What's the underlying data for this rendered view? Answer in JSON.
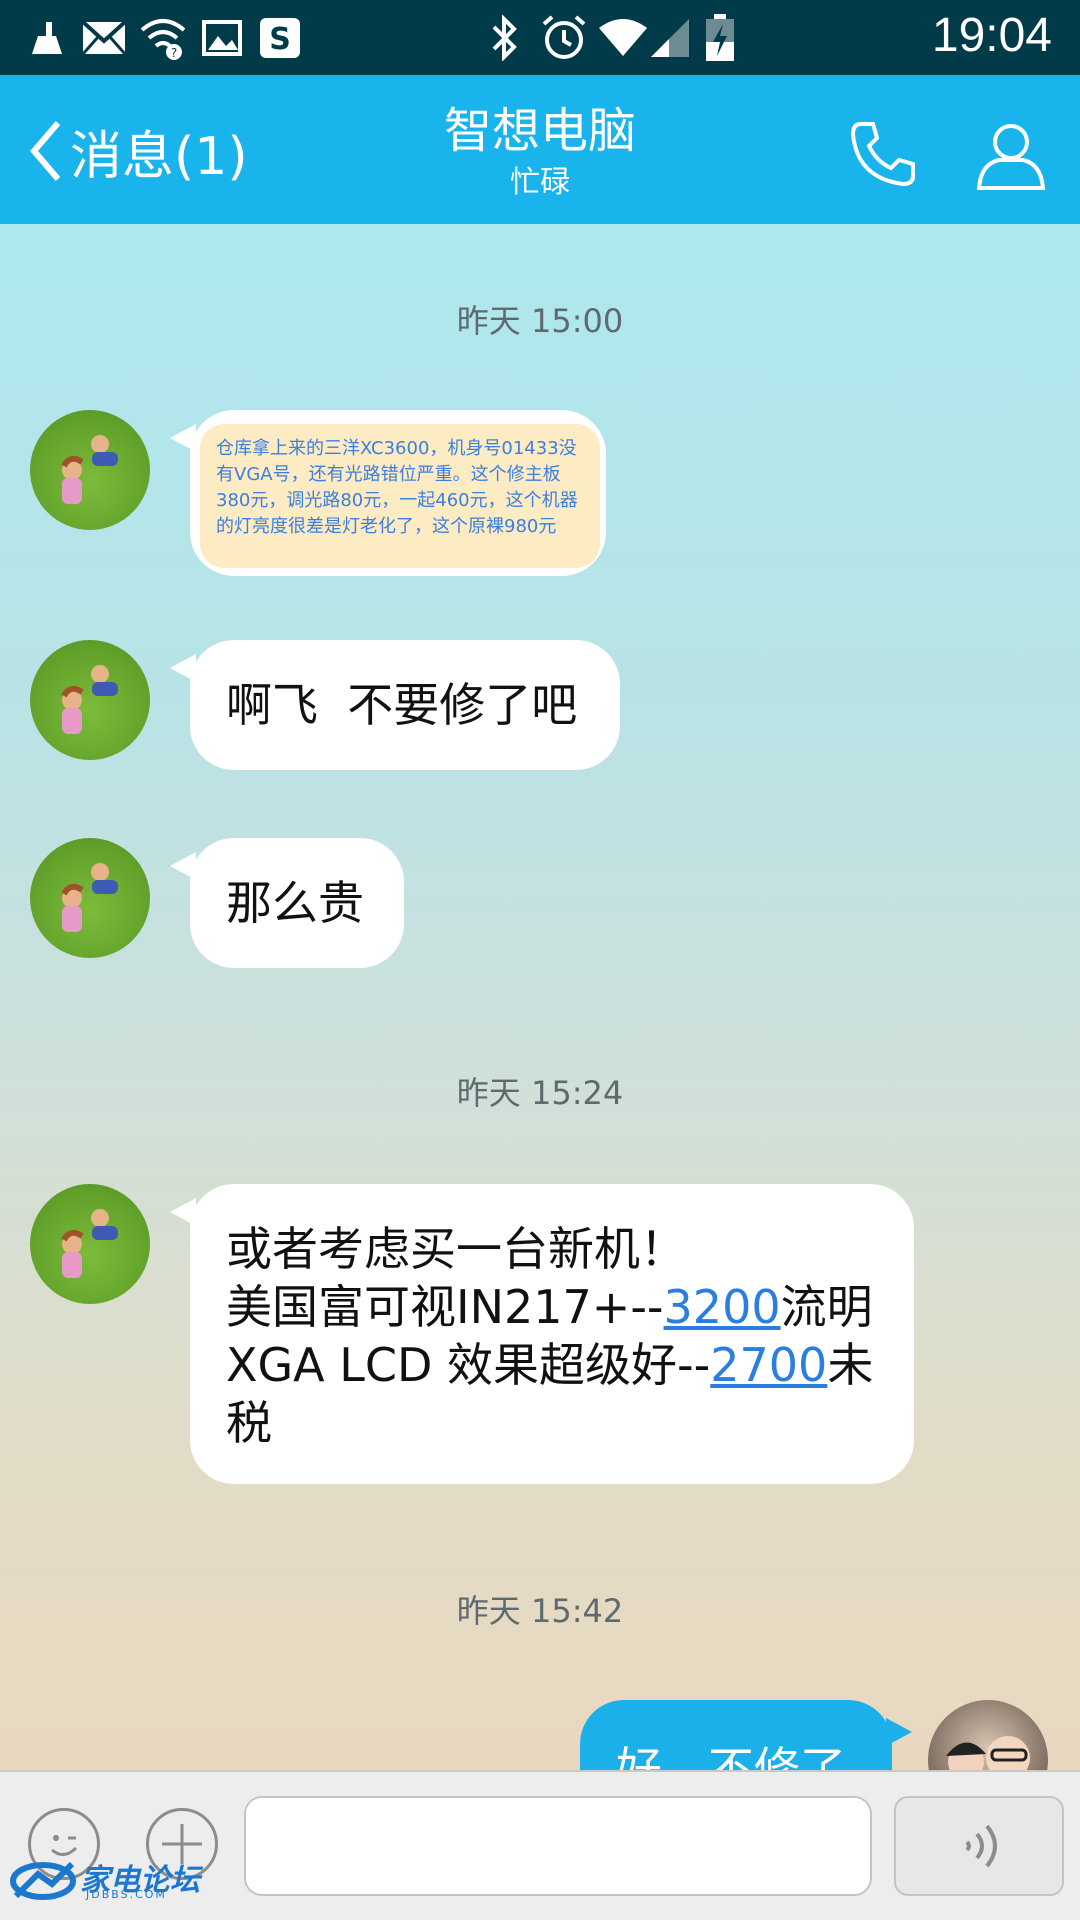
{
  "status_bar": {
    "time": "19:04",
    "left_icons": [
      "cleaner-icon",
      "mail-icon",
      "wifi-question-icon",
      "image-icon",
      "s-app-icon"
    ],
    "right_icons": [
      "bluetooth-icon",
      "alarm-icon",
      "wifi-icon",
      "signal-icon",
      "battery-charging-icon"
    ]
  },
  "header": {
    "back_label": "消息(1)",
    "title": "智想电脑",
    "subtitle": "忙碌",
    "phone_icon": "phone-icon",
    "profile_icon": "person-icon",
    "accent_color": "#19b4eb"
  },
  "chat": {
    "timestamps": [
      "昨天 15:00",
      "昨天 15:24",
      "昨天 15:42"
    ],
    "note_image_text": "仓库拿上来的三洋XC3600，机身号01433没有VGA号，还有光路错位严重。这个修主板380元，调光路80元，一起460元，这个机器的灯亮度很差是灯老化了，这个原裸980元",
    "messages": [
      {
        "text": "啊飞  不要修了吧"
      },
      {
        "text": "那么贵"
      }
    ],
    "long_message": {
      "line1": "或者考虑买一台新机！",
      "line2_a": "美国富可视IN217+--",
      "line2_link": "3200",
      "line2_b": "流明",
      "line3_a": "XGA LCD 效果超级好--",
      "line3_link": "2700",
      "line3_b": "未",
      "line4": "税"
    },
    "outgoing_message": "好，不修了"
  },
  "input_bar": {
    "emoji_icon": "emoji-icon",
    "plus_icon": "plus-icon",
    "input_value": "",
    "voice_icon": "voice-icon"
  },
  "watermark": {
    "text": "家电论坛",
    "sub": "JDBBS.COM"
  }
}
